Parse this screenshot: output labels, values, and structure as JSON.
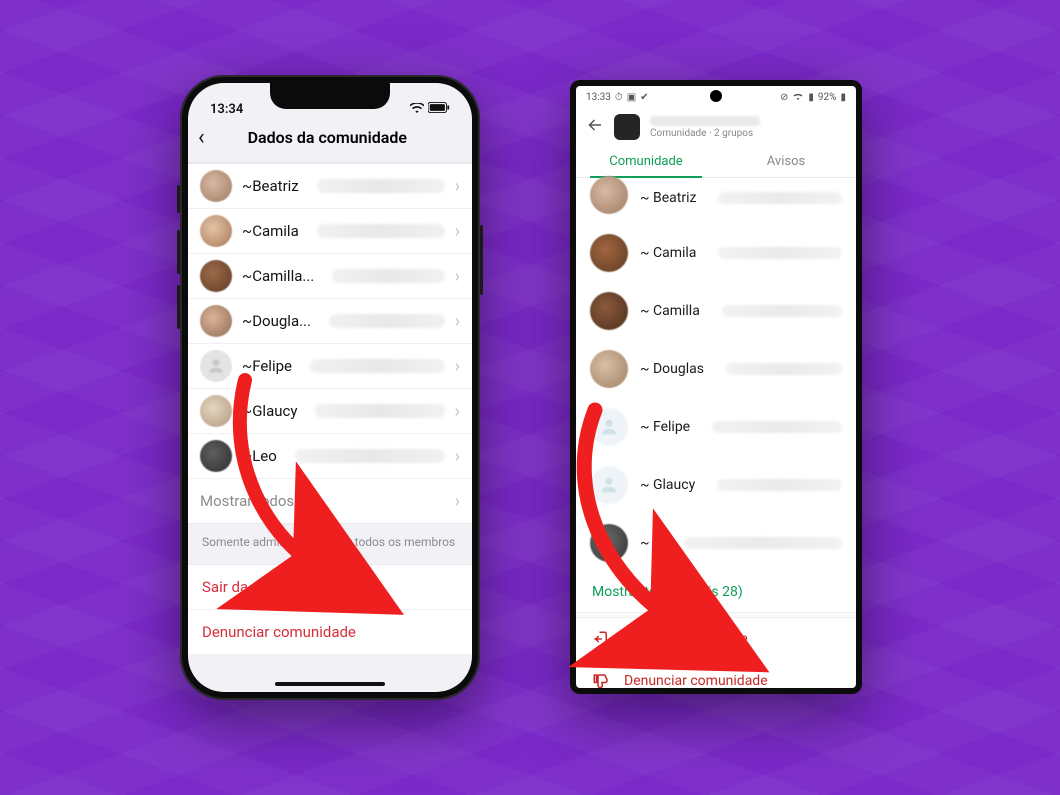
{
  "ios": {
    "statusbar": {
      "time": "13:34"
    },
    "header": {
      "title": "Dados da comunidade"
    },
    "members": [
      {
        "name": "~Beatriz"
      },
      {
        "name": "~Camila"
      },
      {
        "name": "~Camilla..."
      },
      {
        "name": "~Dougla..."
      },
      {
        "name": "~Felipe",
        "placeholder": true
      },
      {
        "name": "~Glaucy"
      },
      {
        "name": "~Leo"
      }
    ],
    "show_all": "Mostrar todos",
    "hint": "Somente admins podem ver todos os membros",
    "leave": "Sair da comunidade",
    "report": "Denunciar comunidade"
  },
  "android": {
    "statusbar": {
      "time": "13:33",
      "battery": "92%"
    },
    "header": {
      "subtitle": "Comunidade · 2 grupos"
    },
    "tabs": {
      "community": "Comunidade",
      "notices": "Avisos"
    },
    "members": [
      {
        "name": "~ Beatriz"
      },
      {
        "name": "~ Camila"
      },
      {
        "name": "~ Camilla"
      },
      {
        "name": "~ Douglas"
      },
      {
        "name": "~ Felipe",
        "placeholder": true
      },
      {
        "name": "~ Glaucy"
      },
      {
        "name": "~ L"
      }
    ],
    "show_all": "Mostrar todos (mais 28)",
    "leave": "Sair da comunidade",
    "report": "Denunciar comunidade"
  },
  "colors": {
    "bg": "#7b29c9",
    "danger": "#c62828",
    "accent_green": "#0f9d58"
  }
}
